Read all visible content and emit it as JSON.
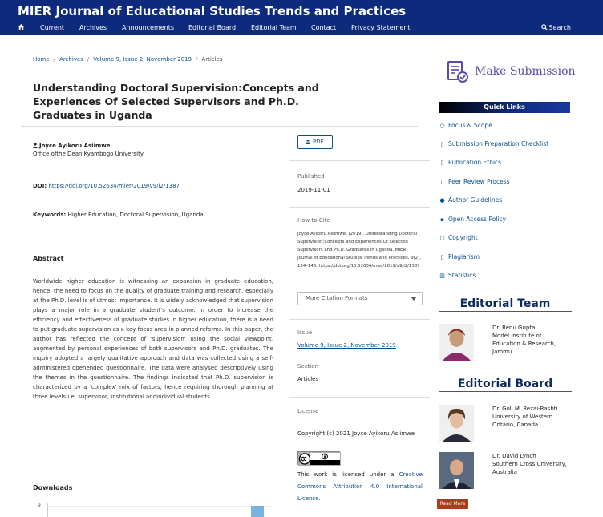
{
  "header": {
    "site_title": "MIER Journal of Educational Studies Trends and Practices"
  },
  "nav": {
    "items": [
      "Current",
      "Archives",
      "Announcements",
      "Editorial Board",
      "Editorial Team",
      "Contact",
      "Privacy Statement"
    ],
    "search_label": "Search"
  },
  "breadcrumb": {
    "home": "Home",
    "archives": "Archives",
    "issue": "Volume 9, Issue 2, November 2019",
    "current": "Articles"
  },
  "article": {
    "title": "Understanding Doctoral Supervision:Concepts and Experiences Of Selected Supervisors and Ph.D. Graduates in Uganda",
    "author": "Joyce Ayikoru Asiimwe",
    "affiliation": "Office ofthe Dean Kyambogo University",
    "doi_label": "DOI:",
    "doi_value": "https://doi.org/10.52634/mier/2019/v9/i2/1387",
    "keywords_label": "Keywords:",
    "keywords_value": "Higher Education, Doctoral Supervision, Uganda.",
    "abstract_heading": "Abstract",
    "abstract": "Worldwide higher education is witnessing an expansion in graduate education, hence, the need to focus on the quality of graduate training and research, especially at the Ph.D. level is of utmost importance. It is widely acknowledged that supervision plays a major role in a graduate student's outcome. In order to increase the efficiency and effectiveness of graduate studies in higher education, there is a need to put graduate supervision as a key focus area in planned reforms. In this paper, the author has reflected the concept of 'supervision' using the social viewpoint, augmented by personal experiences of both supervisors and Ph.D. graduates. The inquiry adopted a largely qualitative approach and data was collected using a self-administered openended questionnaire. The data were analysed descriptively using the themes in the questionnaire. The findings indicated that Ph.D. supervision is characterized by a 'complex' mix of factors, hence requiring thorough planning at three levels i.e. supervisor, institutional andindividual students.",
    "downloads_heading": "Downloads",
    "downloads_axis_tick": "9"
  },
  "details": {
    "pdf_label": "PDF",
    "published_label": "Published",
    "published_value": "2019-11-01",
    "cite_label": "How to Cite",
    "cite_text": "Joyce Ayikoru Asiimwe. (2019). Understanding Doctoral Supervision:Concepts and Experiences Of Selected Supervisors and Ph.D. Graduates in Uganda. MIER Journal of Educational Studies Trends and Practices, 9(2), 134–146. https://doi.org/10.52634/mier/2019/v9/i2/1387",
    "more_formats": "More Citation Formats",
    "issue_label": "Issue",
    "issue_value": "Volume 9, Issue 2, November 2019",
    "section_label": "Section",
    "section_value": "Articles",
    "license_label": "License",
    "copyright": "Copyright (c) 2021 Joyce Ayikoru Asiimwe",
    "license_prefix": "This work is licensed under a",
    "license_link": "Creative Commons Attribution 4.0 International License",
    "license_suffix": "."
  },
  "sidebar": {
    "make_submission": "Make Submission",
    "quick_links_title": "Quick Links",
    "quick_links": [
      {
        "label": "Focus & Scope",
        "icon": "circle-icon"
      },
      {
        "label": "Submission Preparation Checklist",
        "icon": "document-icon"
      },
      {
        "label": "Publication Ethics",
        "icon": "document-icon"
      },
      {
        "label": "Peer Review Process",
        "icon": "document-icon"
      },
      {
        "label": "Author Guidelines",
        "icon": "users-icon"
      },
      {
        "label": "Open Access Policy",
        "icon": "sitemap-icon"
      },
      {
        "label": "Copyright",
        "icon": "circle-icon"
      },
      {
        "label": "Plagiarism",
        "icon": "document-icon"
      },
      {
        "label": "Statistics",
        "icon": "bar-chart-icon"
      }
    ],
    "editorial_team_title": "Editorial Team",
    "editorial_team": [
      {
        "lines": [
          "Dr. Renu Gupta",
          "Model Institute of",
          "Education & Research,",
          "Jammu"
        ]
      }
    ],
    "editorial_board_title": "Editorial Board",
    "editorial_board": [
      {
        "lines": [
          "Dr. Goli M. Rezai-Rashti",
          "University of Western",
          "Ontario, Canada"
        ]
      },
      {
        "lines": [
          "Dr. David Lynch",
          "Southern Cross University,",
          "Australia"
        ]
      }
    ],
    "read_more": "Read More"
  },
  "colors": {
    "header_bg": "#0d2a7c",
    "link": "#0b4f8a",
    "heading": "#0d2a5c",
    "read_more_bg": "#b03a1a"
  }
}
